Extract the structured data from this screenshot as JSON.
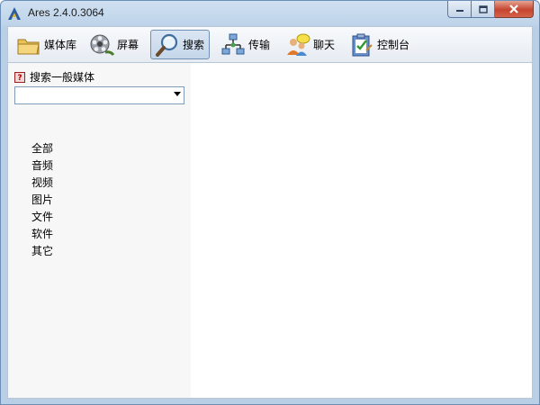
{
  "window": {
    "title": "Ares 2.4.0.3064"
  },
  "toolbar": {
    "items": [
      {
        "label": "媒体库",
        "icon": "folder-icon",
        "active": false
      },
      {
        "label": "屏幕",
        "icon": "film-reel-icon",
        "active": false
      },
      {
        "label": "搜索",
        "icon": "magnifier-icon",
        "active": true
      },
      {
        "label": "传输",
        "icon": "network-transfer-icon",
        "active": false
      },
      {
        "label": "聊天",
        "icon": "chat-users-icon",
        "active": false
      },
      {
        "label": "控制台",
        "icon": "clipboard-check-icon",
        "active": false
      }
    ]
  },
  "search": {
    "title": "搜索一般媒体",
    "help_glyph": "?",
    "media_value": "",
    "categories": [
      "全部",
      "音频",
      "视频",
      "图片",
      "文件",
      "软件",
      "其它"
    ]
  },
  "colors": {
    "titlebar": "#bfd4ea",
    "close_button": "#c5452f",
    "active_tab": "#c5d6ea",
    "pane_bg": "#f7f7f7"
  }
}
